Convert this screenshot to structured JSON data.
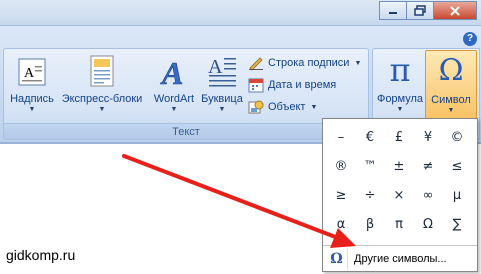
{
  "window": {
    "minimize_icon": "minimize-icon",
    "restore_icon": "restore-icon",
    "close_icon": "close-icon",
    "help_icon": "?"
  },
  "ribbon": {
    "group_text": {
      "label": "Текст",
      "buttons": {
        "textbox": "Надпись",
        "quickparts": "Экспресс-блоки",
        "wordart": "WordArt",
        "dropcap": "Буквица"
      },
      "small_buttons": {
        "signature": "Строка подписи",
        "datetime": "Дата и время",
        "object": "Объект"
      }
    },
    "group_symbols": {
      "equation": "Формула",
      "equation_glyph": "π",
      "symbol": "Символ",
      "symbol_glyph": "Ω"
    }
  },
  "symbol_dropdown": {
    "symbols": [
      [
        "–",
        "€",
        "£",
        "¥",
        "©"
      ],
      [
        "®",
        "™",
        "±",
        "≠",
        "≤"
      ],
      [
        "≥",
        "÷",
        "×",
        "∞",
        "µ"
      ],
      [
        "α",
        "β",
        "π",
        "Ω",
        "∑"
      ]
    ],
    "more_label": "Другие символы...",
    "more_icon_glyph": "Ω"
  },
  "watermark": "gidkomp.ru",
  "colors": {
    "accent_arrow": "#e8201a",
    "selected_button": "#f8b84a"
  }
}
